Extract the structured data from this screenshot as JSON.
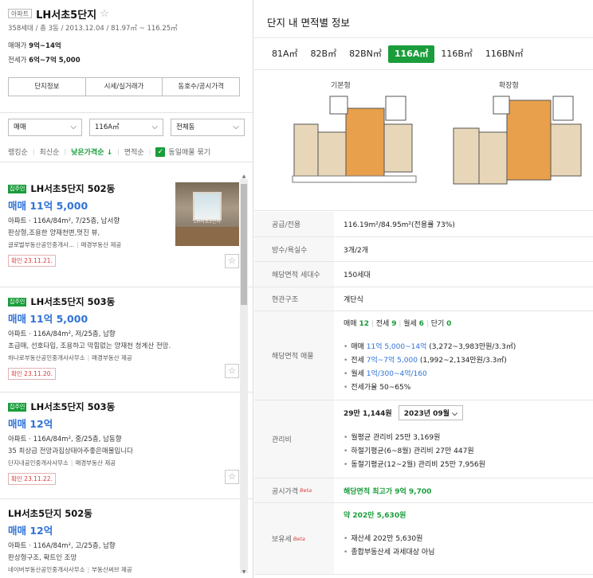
{
  "complex": {
    "type_tag": "아파트",
    "name": "LH서초5단지",
    "meta": "358세대 / 총 3동 / 2013.12.04 / 81.97㎡ ~ 116.25㎡",
    "sale_label": "매매가",
    "sale_value": "9억~14억",
    "jeonse_label": "전세가",
    "jeonse_value": "6억~7억 5,000"
  },
  "info_tabs": [
    "단지정보",
    "시세/실거래가",
    "동호수/공시가격"
  ],
  "filters": {
    "trade": "매매",
    "area": "116A㎡",
    "dong": "전체동"
  },
  "sort": {
    "opt1": "랭킹순",
    "opt2": "최신순",
    "opt3": "낮은가격순 ↓",
    "opt4": "면적순",
    "same_label": "동일매물 묶기"
  },
  "listings": [
    {
      "tag": "집주인",
      "title": "LH서초5단지 502동",
      "price": "매매 11억 5,000",
      "desc": "아파트 · 116A/84m², 7/25층, 남서향",
      "desc2": "판상형,조용한 양재천변,멋진 뷰,",
      "agent": "글로벌부동산공인중개사...",
      "provider": "매경부동산 제공",
      "confirm": "확인 23.11.21.",
      "photo_watermark": "LH서초5단지"
    },
    {
      "tag": "집주인",
      "title": "LH서초5단지 503동",
      "price": "매매 11억 5,000",
      "desc": "아파트 · 116A/84m², 저/25층, 남향",
      "desc2": "초급매, 선호타입, 조용하고 막힘없는 양재천 청계산 전망.",
      "agent": "하나로부동산공인중개사사무소",
      "provider": "매경부동산 제공",
      "confirm": "확인 23.11.20."
    },
    {
      "tag": "집주인",
      "title": "LH서초5단지 503동",
      "price": "매매 12억",
      "desc": "아파트 · 116A/84m², 중/25층, 남동향",
      "desc2": "35 최상급 전망과집상태아주좋은매물입니다",
      "agent": "단지내공인중개사사무소",
      "provider": "매경부동산 제공",
      "confirm": "확인 23.11.22."
    },
    {
      "tag": "",
      "title": "LH서초5단지 502동",
      "price": "매매 12억",
      "desc": "아파트 · 116A/84m², 고/25층, 남향",
      "desc2": "판상형구조, 확트인 조망",
      "agent": "네이버부동산공인중개사사무소",
      "provider": "부동산써브 제공"
    }
  ],
  "right": {
    "title": "단지 내 면적별 정보",
    "size_tabs": [
      "81A㎡",
      "82B㎡",
      "82BN㎡",
      "116A㎡",
      "116B㎡",
      "116BN㎡"
    ],
    "active_tab": "116A㎡",
    "plan_labels": [
      "기본형",
      "확장형"
    ],
    "supply_label": "공급/전용",
    "supply_value": "116.19m²/84.95m²(전용률 73%)",
    "rooms_label": "방수/욕실수",
    "rooms_value": "3개/2개",
    "households_label": "해당면적 세대수",
    "households_value": "150세대",
    "structure_label": "현관구조",
    "structure_value": "계단식",
    "listing_label": "해당면적 매물",
    "counts": {
      "sale": "매매",
      "sale_n": "12",
      "jeonse": "전세",
      "jeonse_n": "9",
      "monthly": "월세",
      "monthly_n": "6",
      "short": "단기",
      "short_n": "0"
    },
    "sale_line_label": "매매",
    "sale_line_value": "11억 5,000~14억",
    "sale_line_unit": "(3,272~3,983만원/3.3㎡)",
    "jeonse_line_label": "전세",
    "jeonse_line_value": "7억~7억 5,000",
    "jeonse_line_unit": "(1,992~2,134만원/3.3㎡)",
    "monthly_line_label": "월세",
    "monthly_line_value": "1억/300~4억/160",
    "jeonse_ratio": "전세가율 50~65%",
    "fee_label": "관리비",
    "fee_total": "29만 1,144원",
    "fee_month": "2023년 09월",
    "fee_avg": "월평균 관리비 25만 3,169원",
    "fee_summer": "하절기평균(6~8월) 관리비 27만 447원",
    "fee_winter": "동절기평균(12~2월) 관리비 25만 7,956원",
    "public_label": "공시가격",
    "beta": "Beta",
    "public_value": "해당면적 최고가 9억 9,700",
    "tax_label": "보유세",
    "tax_total": "약 202만 5,630원",
    "tax_property": "재산세 202만 5,630원",
    "tax_comp": "종합부동산세 과세대상 아님"
  }
}
